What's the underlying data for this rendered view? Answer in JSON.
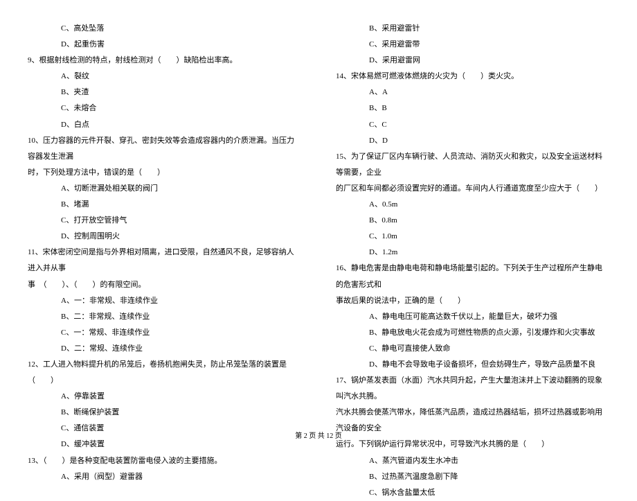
{
  "left": {
    "q8_c": "C、高处坠落",
    "q8_d": "D、起重伤害",
    "q9": "9、根据射线检测的特点，射线检测对（　　）缺陷检出率高。",
    "q9_a": "A、裂纹",
    "q9_b": "B、夹渣",
    "q9_c": "C、未熔合",
    "q9_d": "D、白点",
    "q10": "10、压力容器的元件开裂、穿孔、密封失效等会造成容器内的介质泄漏。当压力容器发生泄漏",
    "q10_cont": "时，下列处理方法中，错误的是（　　）",
    "q10_a": "A、切断泄漏处相关联的阀门",
    "q10_b": "B、堵漏",
    "q10_c": "C、打开放空管排气",
    "q10_d": "D、控制周围明火",
    "q11": "11、宋体密闭空间是指与外界相对隔离，进口受限，自然通风不良，足够容纳人进入并从事",
    "q11_cont": "事　（　　）、（　　）的有限空间。",
    "q11_a": "A、一：非常规、非连续作业",
    "q11_b": "B、二：非常规、连续作业",
    "q11_c": "C、一：常规、非连续作业",
    "q11_d": "D、二：常规、连续作业",
    "q12": "12、工人进入物料提升机的吊笼后，卷扬机抱闸失灵，防止吊笼坠落的装置是（　　）",
    "q12_a": "A、停靠装置",
    "q12_b": "B、断绳保护装置",
    "q12_c": "C、通信装置",
    "q12_d": "D、缓冲装置",
    "q13": "13、（　　）是各种变配电装置防雷电侵入波的主要措施。",
    "q13_a": "A、采用（阀型）避雷器"
  },
  "right": {
    "q13_b": "B、采用避雷针",
    "q13_c": "C、采用避雷带",
    "q13_d": "D、采用避雷网",
    "q14": "14、宋体易燃可燃液体燃烧的火灾为（　　）类火灾。",
    "q14_a": "A、A",
    "q14_b": "B、B",
    "q14_c": "C、C",
    "q14_d": "D、D",
    "q15": "15、为了保证厂区内车辆行驶、人员流动、消防灭火和救灾，以及安全运送材料等需要，企业",
    "q15_cont": "的厂区和车间都必须设置完好的通道。车间内人行通道宽度至少应大于（　　）",
    "q15_a": "A、0.5m",
    "q15_b": "B、0.8m",
    "q15_c": "C、1.0m",
    "q15_d": "D、1.2m",
    "q16": "16、静电危害是由静电电荷和静电场能量引起的。下列关于生产过程所产生静电的危害形式和",
    "q16_cont": "事故后果的说法中，正确的是（　　）",
    "q16_a": "A、静电电压可能高达数千伏以上，能量巨大，破坏力强",
    "q16_b": "B、静电放电火花会成为可燃性物质的点火源，引发爆炸和火灾事故",
    "q16_c": "C、静电可直接使人致命",
    "q16_d": "D、静电不会导致电子设备损坏，但会妨碍生产，导致产品质量不良",
    "q17": "17、锅炉蒸发表面（水面）汽水共同升起，产生大量泡沫并上下波动翻腾的现象叫汽水共腾。",
    "q17_cont1": "汽水共腾会使蒸汽带水，降低蒸汽品质，造成过热器结垢，损坏过热器或影响用汽设备的安全",
    "q17_cont2": "运行。下列锅炉运行异常状况中，可导致汽水共腾的是（　　）",
    "q17_a": "A、蒸汽管道内发生水冲击",
    "q17_b": "B、过热蒸汽温度急剧下降",
    "q17_c": "C、锅水含盐量太低"
  },
  "footer": "第 2 页 共 12 页"
}
